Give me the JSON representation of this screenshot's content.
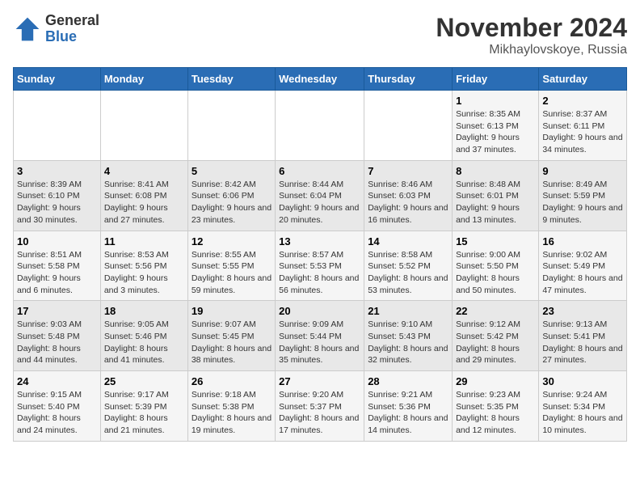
{
  "logo": {
    "general": "General",
    "blue": "Blue"
  },
  "header": {
    "month": "November 2024",
    "location": "Mikhaylovskoye, Russia"
  },
  "days_of_week": [
    "Sunday",
    "Monday",
    "Tuesday",
    "Wednesday",
    "Thursday",
    "Friday",
    "Saturday"
  ],
  "weeks": [
    [
      {
        "day": "",
        "info": ""
      },
      {
        "day": "",
        "info": ""
      },
      {
        "day": "",
        "info": ""
      },
      {
        "day": "",
        "info": ""
      },
      {
        "day": "",
        "info": ""
      },
      {
        "day": "1",
        "info": "Sunrise: 8:35 AM\nSunset: 6:13 PM\nDaylight: 9 hours and 37 minutes."
      },
      {
        "day": "2",
        "info": "Sunrise: 8:37 AM\nSunset: 6:11 PM\nDaylight: 9 hours and 34 minutes."
      }
    ],
    [
      {
        "day": "3",
        "info": "Sunrise: 8:39 AM\nSunset: 6:10 PM\nDaylight: 9 hours and 30 minutes."
      },
      {
        "day": "4",
        "info": "Sunrise: 8:41 AM\nSunset: 6:08 PM\nDaylight: 9 hours and 27 minutes."
      },
      {
        "day": "5",
        "info": "Sunrise: 8:42 AM\nSunset: 6:06 PM\nDaylight: 9 hours and 23 minutes."
      },
      {
        "day": "6",
        "info": "Sunrise: 8:44 AM\nSunset: 6:04 PM\nDaylight: 9 hours and 20 minutes."
      },
      {
        "day": "7",
        "info": "Sunrise: 8:46 AM\nSunset: 6:03 PM\nDaylight: 9 hours and 16 minutes."
      },
      {
        "day": "8",
        "info": "Sunrise: 8:48 AM\nSunset: 6:01 PM\nDaylight: 9 hours and 13 minutes."
      },
      {
        "day": "9",
        "info": "Sunrise: 8:49 AM\nSunset: 5:59 PM\nDaylight: 9 hours and 9 minutes."
      }
    ],
    [
      {
        "day": "10",
        "info": "Sunrise: 8:51 AM\nSunset: 5:58 PM\nDaylight: 9 hours and 6 minutes."
      },
      {
        "day": "11",
        "info": "Sunrise: 8:53 AM\nSunset: 5:56 PM\nDaylight: 9 hours and 3 minutes."
      },
      {
        "day": "12",
        "info": "Sunrise: 8:55 AM\nSunset: 5:55 PM\nDaylight: 8 hours and 59 minutes."
      },
      {
        "day": "13",
        "info": "Sunrise: 8:57 AM\nSunset: 5:53 PM\nDaylight: 8 hours and 56 minutes."
      },
      {
        "day": "14",
        "info": "Sunrise: 8:58 AM\nSunset: 5:52 PM\nDaylight: 8 hours and 53 minutes."
      },
      {
        "day": "15",
        "info": "Sunrise: 9:00 AM\nSunset: 5:50 PM\nDaylight: 8 hours and 50 minutes."
      },
      {
        "day": "16",
        "info": "Sunrise: 9:02 AM\nSunset: 5:49 PM\nDaylight: 8 hours and 47 minutes."
      }
    ],
    [
      {
        "day": "17",
        "info": "Sunrise: 9:03 AM\nSunset: 5:48 PM\nDaylight: 8 hours and 44 minutes."
      },
      {
        "day": "18",
        "info": "Sunrise: 9:05 AM\nSunset: 5:46 PM\nDaylight: 8 hours and 41 minutes."
      },
      {
        "day": "19",
        "info": "Sunrise: 9:07 AM\nSunset: 5:45 PM\nDaylight: 8 hours and 38 minutes."
      },
      {
        "day": "20",
        "info": "Sunrise: 9:09 AM\nSunset: 5:44 PM\nDaylight: 8 hours and 35 minutes."
      },
      {
        "day": "21",
        "info": "Sunrise: 9:10 AM\nSunset: 5:43 PM\nDaylight: 8 hours and 32 minutes."
      },
      {
        "day": "22",
        "info": "Sunrise: 9:12 AM\nSunset: 5:42 PM\nDaylight: 8 hours and 29 minutes."
      },
      {
        "day": "23",
        "info": "Sunrise: 9:13 AM\nSunset: 5:41 PM\nDaylight: 8 hours and 27 minutes."
      }
    ],
    [
      {
        "day": "24",
        "info": "Sunrise: 9:15 AM\nSunset: 5:40 PM\nDaylight: 8 hours and 24 minutes."
      },
      {
        "day": "25",
        "info": "Sunrise: 9:17 AM\nSunset: 5:39 PM\nDaylight: 8 hours and 21 minutes."
      },
      {
        "day": "26",
        "info": "Sunrise: 9:18 AM\nSunset: 5:38 PM\nDaylight: 8 hours and 19 minutes."
      },
      {
        "day": "27",
        "info": "Sunrise: 9:20 AM\nSunset: 5:37 PM\nDaylight: 8 hours and 17 minutes."
      },
      {
        "day": "28",
        "info": "Sunrise: 9:21 AM\nSunset: 5:36 PM\nDaylight: 8 hours and 14 minutes."
      },
      {
        "day": "29",
        "info": "Sunrise: 9:23 AM\nSunset: 5:35 PM\nDaylight: 8 hours and 12 minutes."
      },
      {
        "day": "30",
        "info": "Sunrise: 9:24 AM\nSunset: 5:34 PM\nDaylight: 8 hours and 10 minutes."
      }
    ]
  ]
}
